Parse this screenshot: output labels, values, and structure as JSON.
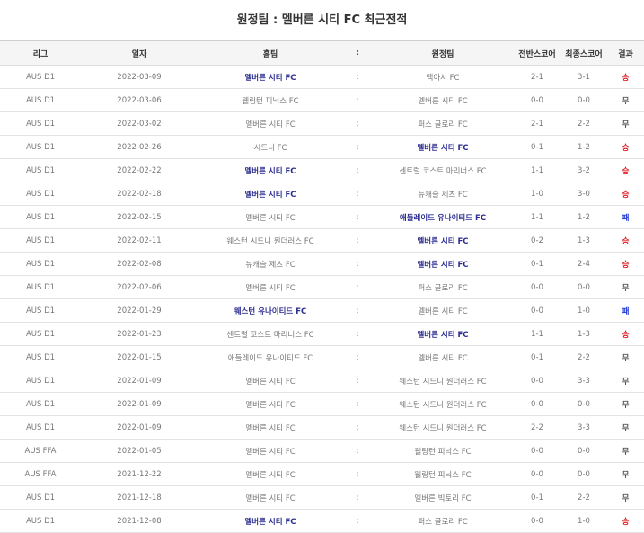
{
  "title": "원정팀 : 멜버른 시티 FC 최근전적",
  "headers": {
    "league": "리그",
    "date": "일자",
    "home": "홈팀",
    "sep": ":",
    "away": "원정팀",
    "half": "전반스코어",
    "final": "최종스코어",
    "result": "결과"
  },
  "rows": [
    {
      "league": "AUS D1",
      "date": "2022-03-09",
      "home": "멜버른 시티 FC",
      "home_bold": true,
      "sep": ":",
      "away": "맥아서 FC",
      "away_bold": false,
      "half": "2-1",
      "final": "3-1",
      "result": "승",
      "result_type": "win"
    },
    {
      "league": "AUS D1",
      "date": "2022-03-06",
      "home": "웰링턴 피닉스 FC",
      "home_bold": false,
      "sep": ":",
      "away": "멜버른 시티 FC",
      "away_bold": false,
      "half": "0-0",
      "final": "0-0",
      "result": "무",
      "result_type": "draw"
    },
    {
      "league": "AUS D1",
      "date": "2022-03-02",
      "home": "멜버른 시티 FC",
      "home_bold": false,
      "sep": ":",
      "away": "퍼스 글로리 FC",
      "away_bold": false,
      "half": "2-1",
      "final": "2-2",
      "result": "무",
      "result_type": "draw"
    },
    {
      "league": "AUS D1",
      "date": "2022-02-26",
      "home": "시드니 FC",
      "home_bold": false,
      "sep": ":",
      "away": "멜버른 시티 FC",
      "away_bold": true,
      "half": "0-1",
      "final": "1-2",
      "result": "승",
      "result_type": "win"
    },
    {
      "league": "AUS D1",
      "date": "2022-02-22",
      "home": "멜버른 시티 FC",
      "home_bold": true,
      "sep": ":",
      "away": "센트럴 코스트 마리너스 FC",
      "away_bold": false,
      "half": "1-1",
      "final": "3-2",
      "result": "승",
      "result_type": "win"
    },
    {
      "league": "AUS D1",
      "date": "2022-02-18",
      "home": "멜버른 시티 FC",
      "home_bold": true,
      "sep": ":",
      "away": "뉴캐슬 제츠 FC",
      "away_bold": false,
      "half": "1-0",
      "final": "3-0",
      "result": "승",
      "result_type": "win"
    },
    {
      "league": "AUS D1",
      "date": "2022-02-15",
      "home": "멜버른 시티 FC",
      "home_bold": false,
      "sep": ":",
      "away": "애들레이드 유나이티드 FC",
      "away_bold": true,
      "half": "1-1",
      "final": "1-2",
      "result": "패",
      "result_type": "lose"
    },
    {
      "league": "AUS D1",
      "date": "2022-02-11",
      "home": "웨스턴 시드니 원더러스 FC",
      "home_bold": false,
      "sep": ":",
      "away": "멜버른 시티 FC",
      "away_bold": true,
      "half": "0-2",
      "final": "1-3",
      "result": "승",
      "result_type": "win"
    },
    {
      "league": "AUS D1",
      "date": "2022-02-08",
      "home": "뉴캐슬 제츠 FC",
      "home_bold": false,
      "sep": ":",
      "away": "멜버른 시티 FC",
      "away_bold": true,
      "half": "0-1",
      "final": "2-4",
      "result": "승",
      "result_type": "win"
    },
    {
      "league": "AUS D1",
      "date": "2022-02-06",
      "home": "멜버른 시티 FC",
      "home_bold": false,
      "sep": ":",
      "away": "퍼스 글로리 FC",
      "away_bold": false,
      "half": "0-0",
      "final": "0-0",
      "result": "무",
      "result_type": "draw"
    },
    {
      "league": "AUS D1",
      "date": "2022-01-29",
      "home": "웨스턴 유나이티드 FC",
      "home_bold": true,
      "sep": ":",
      "away": "멜버른 시티 FC",
      "away_bold": false,
      "half": "0-0",
      "final": "1-0",
      "result": "패",
      "result_type": "lose"
    },
    {
      "league": "AUS D1",
      "date": "2022-01-23",
      "home": "센트럴 코스트 마리너스 FC",
      "home_bold": false,
      "sep": ":",
      "away": "멜버른 시티 FC",
      "away_bold": true,
      "half": "1-1",
      "final": "1-3",
      "result": "승",
      "result_type": "win"
    },
    {
      "league": "AUS D1",
      "date": "2022-01-15",
      "home": "애들레이드 유나이티드 FC",
      "home_bold": false,
      "sep": ":",
      "away": "멜버른 시티 FC",
      "away_bold": false,
      "half": "0-1",
      "final": "2-2",
      "result": "무",
      "result_type": "draw"
    },
    {
      "league": "AUS D1",
      "date": "2022-01-09",
      "home": "멜버른 시티 FC",
      "home_bold": false,
      "sep": ":",
      "away": "웨스턴 시드니 원더러스 FC",
      "away_bold": false,
      "half": "0-0",
      "final": "3-3",
      "result": "무",
      "result_type": "draw"
    },
    {
      "league": "AUS D1",
      "date": "2022-01-09",
      "home": "멜버른 시티 FC",
      "home_bold": false,
      "sep": ":",
      "away": "웨스턴 시드니 원더러스 FC",
      "away_bold": false,
      "half": "0-0",
      "final": "0-0",
      "result": "무",
      "result_type": "draw"
    },
    {
      "league": "AUS D1",
      "date": "2022-01-09",
      "home": "멜버른 시티 FC",
      "home_bold": false,
      "sep": ":",
      "away": "웨스턴 시드니 원더러스 FC",
      "away_bold": false,
      "half": "2-2",
      "final": "3-3",
      "result": "무",
      "result_type": "draw"
    },
    {
      "league": "AUS FFA",
      "date": "2022-01-05",
      "home": "멜버른 시티 FC",
      "home_bold": false,
      "sep": ":",
      "away": "웰링턴 피닉스 FC",
      "away_bold": false,
      "half": "0-0",
      "final": "0-0",
      "result": "무",
      "result_type": "draw"
    },
    {
      "league": "AUS FFA",
      "date": "2021-12-22",
      "home": "멜버른 시티 FC",
      "home_bold": false,
      "sep": ":",
      "away": "웰링턴 피닉스 FC",
      "away_bold": false,
      "half": "0-0",
      "final": "0-0",
      "result": "무",
      "result_type": "draw"
    },
    {
      "league": "AUS D1",
      "date": "2021-12-18",
      "home": "멜버른 시티 FC",
      "home_bold": false,
      "sep": ":",
      "away": "멜버른 빅토리 FC",
      "away_bold": false,
      "half": "0-1",
      "final": "2-2",
      "result": "무",
      "result_type": "draw"
    },
    {
      "league": "AUS D1",
      "date": "2021-12-08",
      "home": "멜버른 시티 FC",
      "home_bold": true,
      "sep": ":",
      "away": "퍼스 글로리 FC",
      "away_bold": false,
      "half": "0-0",
      "final": "1-0",
      "result": "승",
      "result_type": "win"
    }
  ]
}
